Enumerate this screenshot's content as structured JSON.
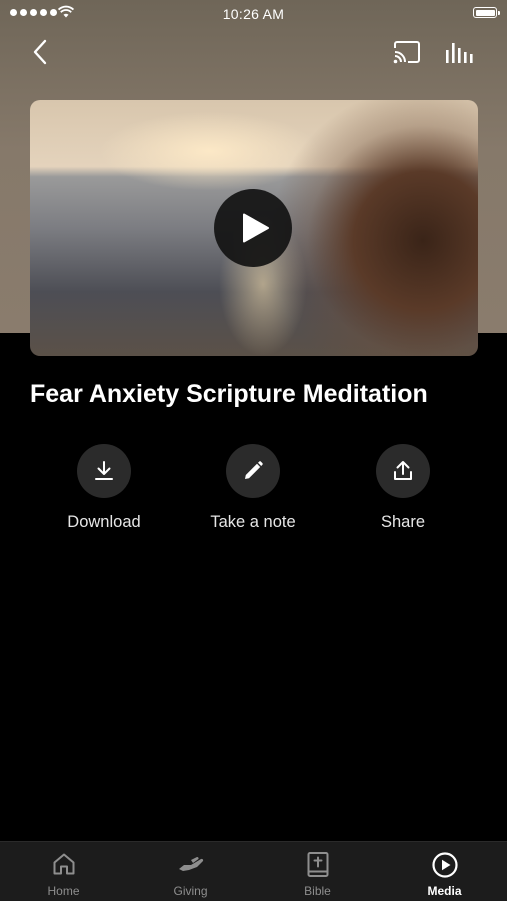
{
  "status_bar": {
    "time": "10:26 AM"
  },
  "video": {
    "title": "Fear Anxiety Scripture Meditation"
  },
  "actions": [
    {
      "label": "Download",
      "icon": "download-icon"
    },
    {
      "label": "Take a note",
      "icon": "pencil-icon"
    },
    {
      "label": "Share",
      "icon": "share-icon"
    }
  ],
  "tabs": [
    {
      "label": "Home",
      "icon": "home-icon",
      "active": false
    },
    {
      "label": "Giving",
      "icon": "giving-hand-icon",
      "active": false
    },
    {
      "label": "Bible",
      "icon": "bible-icon",
      "active": false
    },
    {
      "label": "Media",
      "icon": "play-circle-icon",
      "active": true
    }
  ],
  "colors": {
    "background": "#000000",
    "header": "#86796a",
    "tab_bar": "#1c1c1c",
    "action_circle": "#2b2b2b"
  }
}
